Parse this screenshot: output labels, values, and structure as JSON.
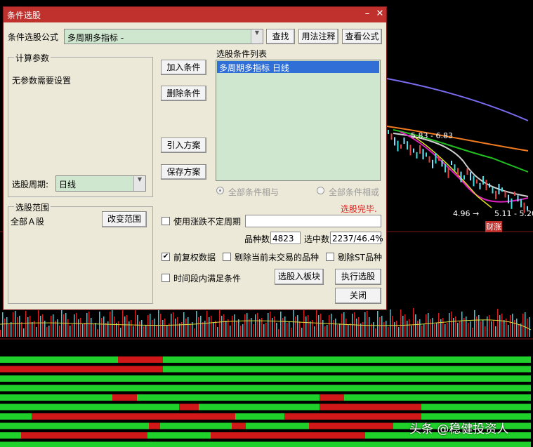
{
  "window": {
    "title": "条件选股"
  },
  "formula": {
    "label": "条件选股公式",
    "value": "多周期多指标 -",
    "find_btn": "查找",
    "usage_btn": "用法注释",
    "view_btn": "查看公式"
  },
  "params": {
    "title": "计算参数",
    "text": "无参数需要设置",
    "period_label": "选股周期:",
    "period_value": "日线"
  },
  "actions": {
    "add": "加入条件",
    "delete": "删除条件",
    "import": "引入方案",
    "save": "保存方案"
  },
  "conditions": {
    "title": "选股条件列表",
    "items": [
      "多周期多指标  日线"
    ],
    "and_label": "全部条件相与",
    "or_label": "全部条件相或",
    "status": "选股完毕."
  },
  "range": {
    "title": "选股范围",
    "value": "全部Ａ股",
    "change_btn": "改变范围"
  },
  "options": {
    "uncertain_period": "使用涨跌不定周期",
    "count_label": "品种数",
    "count_value": "4823",
    "selected_label": "选中数",
    "selected_value": "2237/46.4%",
    "forward_adjust": "前复权数据",
    "forward_adjust_checked": true,
    "exclude_untraded": "剔除当前未交易的品种",
    "exclude_st": "剔除ST品种",
    "time_range": "时间段内满足条件",
    "to_block_btn": "选股入板块",
    "execute_btn": "执行选股",
    "close_btn": "关闭"
  },
  "chart_bg": {
    "price_high": "5.83",
    "price_high2": "6.83",
    "price_low": "4.96",
    "date_range": "5.11 - 5.20",
    "marker": "财涨"
  },
  "watermark": "头条 @稳健投资人",
  "colors": {
    "title_bar": "#c0302d",
    "dialog_bg": "#ece9d8",
    "list_bg": "#cfe6cf",
    "selection": "#2f6fd6",
    "status_red": "#e02020",
    "strip_green": "#1fcf2a",
    "strip_red": "#d01818"
  }
}
